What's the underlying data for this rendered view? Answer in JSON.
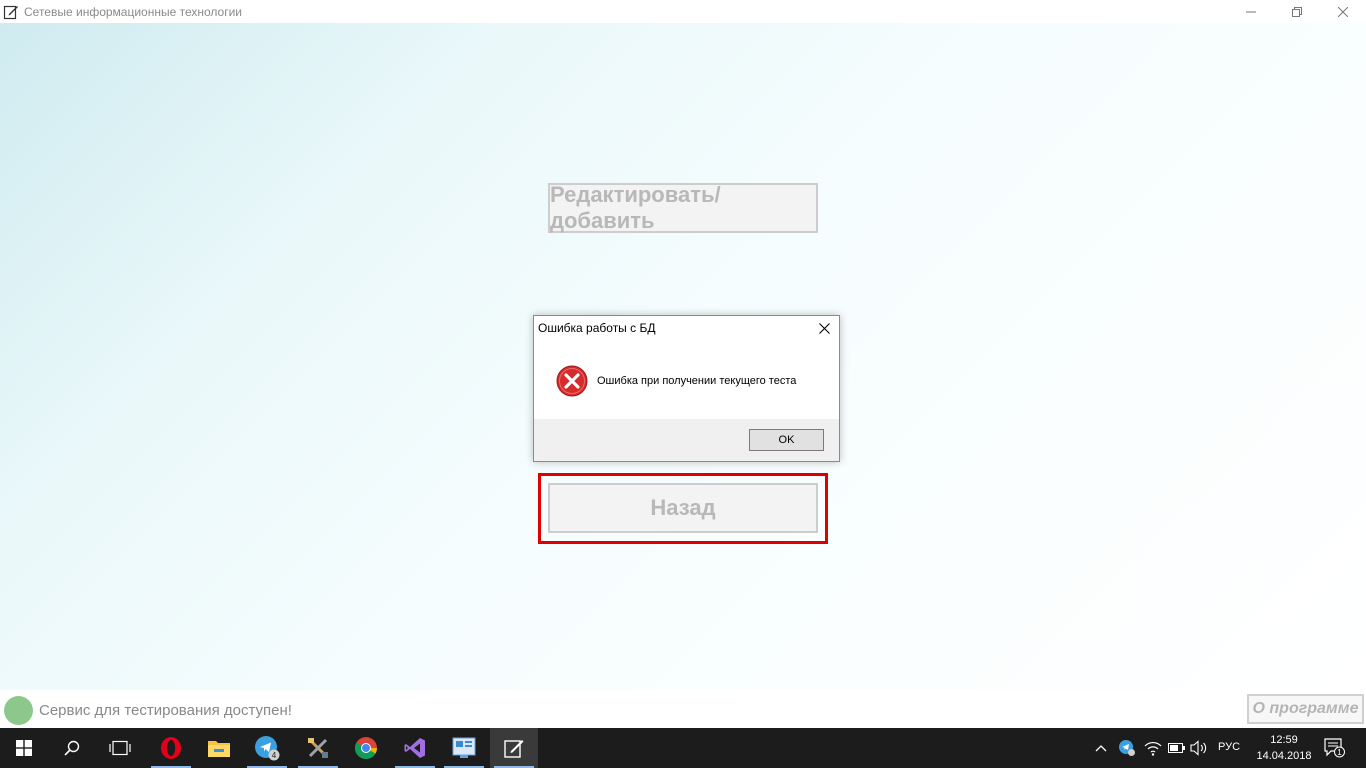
{
  "window": {
    "title": "Сетевые информационные технологии"
  },
  "main": {
    "edit_button_label": "Редактировать/добавить",
    "back_button_label": "Назад"
  },
  "dialog": {
    "title": "Ошибка работы с БД",
    "message": "Ошибка при получении текущего теста",
    "ok_label": "OK"
  },
  "status": {
    "text": "Сервис для тестирования доступен!",
    "about_label": "О программе",
    "indicator_color": "#8cc88c"
  },
  "taskbar": {
    "items": [
      "start-icon",
      "search-icon",
      "task-view-icon",
      "opera-icon",
      "file-explorer-icon",
      "telegram-icon",
      "tools-icon",
      "chrome-icon",
      "visual-studio-icon",
      "app-icon",
      "notepad-app-icon"
    ],
    "telegram_badge": "4",
    "language": "РУС",
    "time": "12:59",
    "date": "14.04.2018",
    "notification_count": "1"
  },
  "colors": {
    "highlight_border": "#e00000",
    "error_icon": "#d62b2b"
  }
}
